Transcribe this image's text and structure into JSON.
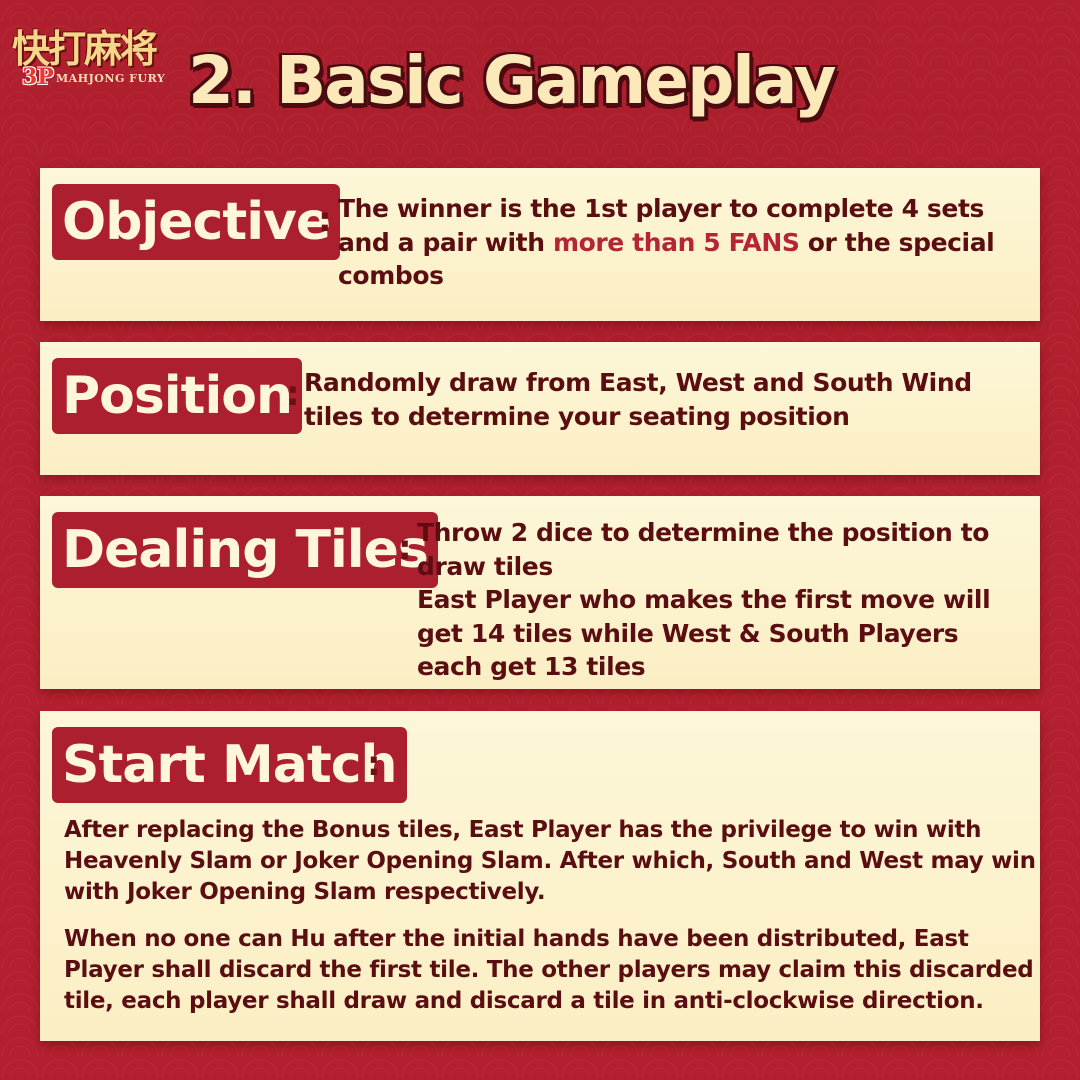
{
  "logo": {
    "chinese": "快打麻将",
    "badge": "3P",
    "english": "MAHJONG FURY"
  },
  "header": {
    "title": "2. Basic Gameplay"
  },
  "sections": {
    "objective": {
      "label": "Objective",
      "colon": ":",
      "text_before": "The winner is the 1st player to complete 4 sets and a pair with ",
      "highlight": "more than 5 FANS",
      "text_after": " or the special combos"
    },
    "position": {
      "label": "Position",
      "colon": ":",
      "text": "Randomly draw from East, West and South Wind tiles to determine your seating position"
    },
    "dealing": {
      "label": "Dealing Tiles",
      "colon": ":",
      "line1": "Throw 2 dice to determine the position to draw tiles",
      "line2": "East Player who makes the first move will get 14 tiles while West & South Players each get 13 tiles"
    },
    "start": {
      "label": "Start Match",
      "colon": ":",
      "paragraph1": "After replacing the Bonus tiles, East Player has the privilege to win with Heavenly Slam or Joker Opening Slam. After which, South and West may win with Joker Opening Slam respectively.",
      "paragraph2": "When no one can Hu after the initial hands have been distributed, East Player shall discard the first tile.  The other players may claim this discarded tile, each player shall draw and discard a tile in anti-clockwise direction."
    }
  },
  "colors": {
    "background": "#b4202f",
    "card": "#fdf7d8",
    "label_bg": "#ab1f2f",
    "label_text": "#fff6dc",
    "body_text": "#5b0e12",
    "highlight": "#b42535",
    "title_text": "#fbe9b9"
  }
}
